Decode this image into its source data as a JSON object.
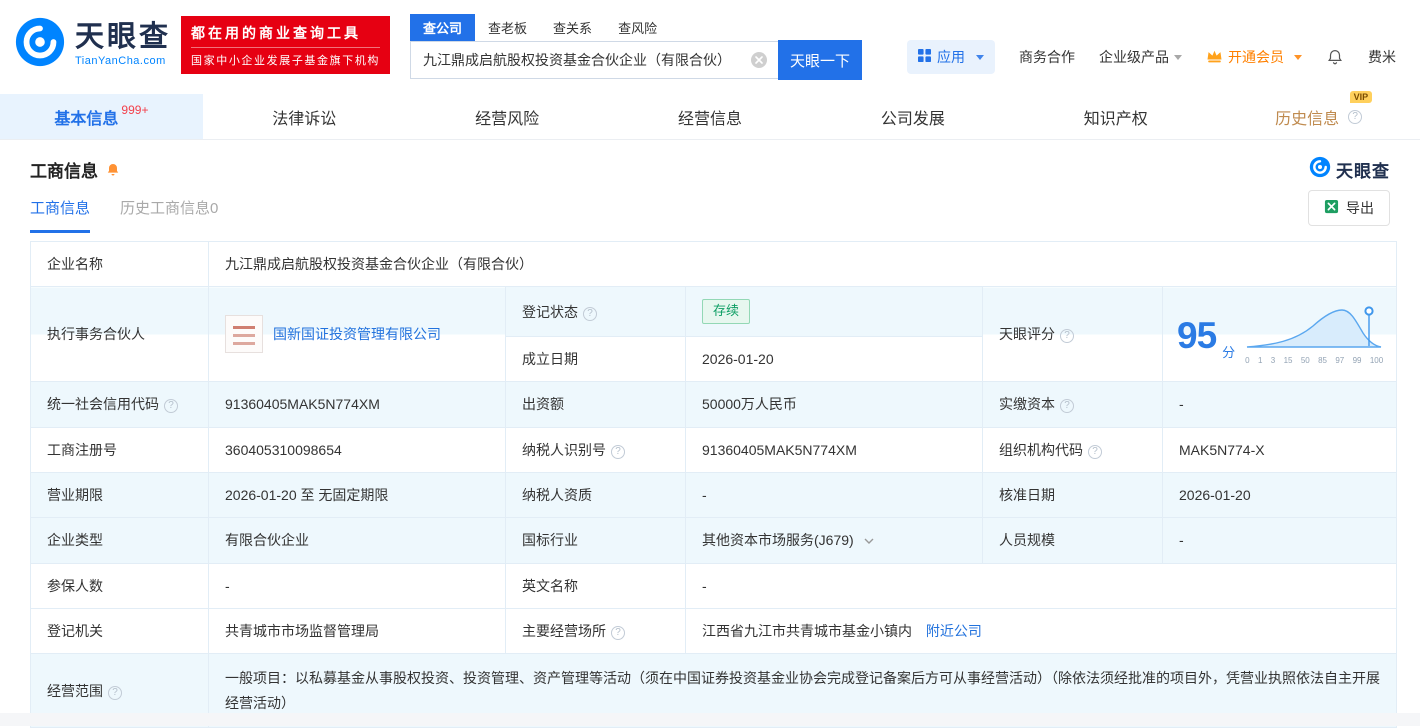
{
  "header": {
    "brand": {
      "name": "天眼查",
      "domain": "TianYanCha.com"
    },
    "slogan": {
      "line1": "都在用的商业查询工具",
      "line2": "国家中小企业发展子基金旗下机构"
    },
    "search": {
      "tabs": [
        {
          "label": "查公司"
        },
        {
          "label": "查老板"
        },
        {
          "label": "查关系"
        },
        {
          "label": "查风险"
        }
      ],
      "value": "九江鼎成启航股权投资基金合伙企业（有限合伙）",
      "button": "天眼一下"
    },
    "nav_right": {
      "apps": "应用",
      "cooperation": "商务合作",
      "enterprise": "企业级产品",
      "vip": "开通会员",
      "user": "费米"
    }
  },
  "tabs": {
    "items": [
      {
        "label": "基本信息",
        "badge": "999+"
      },
      {
        "label": "法律诉讼"
      },
      {
        "label": "经营风险"
      },
      {
        "label": "经营信息"
      },
      {
        "label": "公司发展"
      },
      {
        "label": "知识产权"
      },
      {
        "label": "历史信息",
        "vip": "VIP"
      }
    ]
  },
  "section": {
    "title": "工商信息",
    "watermark": "天眼查",
    "subtabs": [
      {
        "label": "工商信息"
      },
      {
        "label": "历史工商信息0"
      }
    ],
    "export": "导出"
  },
  "score": {
    "label": "天眼评分",
    "value": "95",
    "unit": "分",
    "axis": [
      "0",
      "1",
      "3",
      "15",
      "50",
      "85",
      "97",
      "99",
      "100"
    ]
  },
  "fields": {
    "company_name": {
      "label": "企业名称",
      "value": "九江鼎成启航股权投资基金合伙企业（有限合伙）"
    },
    "executive_partner": {
      "label": "执行事务合伙人",
      "value": "国新国证投资管理有限公司"
    },
    "reg_status": {
      "label": "登记状态",
      "value": "存续"
    },
    "establish_date": {
      "label": "成立日期",
      "value": "2026-01-20"
    },
    "credit_code": {
      "label": "统一社会信用代码",
      "value": "91360405MAK5N774XM"
    },
    "contribution": {
      "label": "出资额",
      "value": "50000万人民币"
    },
    "paid_capital": {
      "label": "实缴资本",
      "value": "-"
    },
    "reg_number": {
      "label": "工商注册号",
      "value": "360405310098654"
    },
    "taxpayer_id": {
      "label": "纳税人识别号",
      "value": "91360405MAK5N774XM"
    },
    "org_code": {
      "label": "组织机构代码",
      "value": "MAK5N774-X"
    },
    "business_term": {
      "label": "营业期限",
      "value": "2026-01-20 至 无固定期限"
    },
    "taxpayer_quality": {
      "label": "纳税人资质",
      "value": "-"
    },
    "approval_date": {
      "label": "核准日期",
      "value": "2026-01-20"
    },
    "company_type": {
      "label": "企业类型",
      "value": "有限合伙企业"
    },
    "industry": {
      "label": "国标行业",
      "value": "其他资本市场服务(J679)"
    },
    "staff_size": {
      "label": "人员规模",
      "value": "-"
    },
    "insured_count": {
      "label": "参保人数",
      "value": "-"
    },
    "english_name": {
      "label": "英文名称",
      "value": "-"
    },
    "reg_authority": {
      "label": "登记机关",
      "value": "共青城市市场监督管理局"
    },
    "main_place": {
      "label": "主要经营场所",
      "value": "江西省九江市共青城市基金小镇内",
      "nearby_link": "附近公司"
    },
    "business_scope": {
      "label": "经营范围",
      "value": "一般项目：以私募基金从事股权投资、投资管理、资产管理等活动（须在中国证券投资基金业协会完成登记备案后方可从事经营活动）（除依法须经批准的项目外，凭营业执照依法自主开展经营活动）"
    }
  }
}
